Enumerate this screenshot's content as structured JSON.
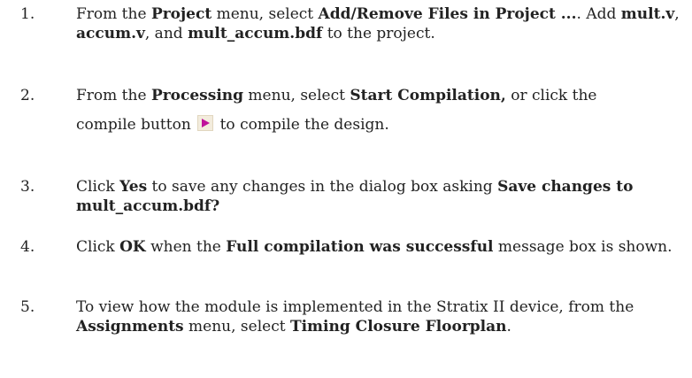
{
  "steps": [
    {
      "number": "1.",
      "parts": [
        "From the ",
        "Project",
        " menu, select ",
        "Add/Remove Files in Project ...",
        ". Add ",
        "mult.v",
        ", ",
        "accum.v",
        ", and ",
        "mult_accum.bdf",
        " to the project."
      ]
    },
    {
      "number": "2.",
      "parts": [
        "From the ",
        "Processing",
        " menu, select ",
        "Start Compilation,",
        " or click the",
        "compile button ",
        "to compile the design."
      ],
      "icon": "compile-play-icon"
    },
    {
      "number": "3.",
      "parts": [
        "Click ",
        "Yes",
        " to save any changes in the dialog box asking ",
        "Save changes to mult_accum.bdf?"
      ]
    },
    {
      "number": "4.",
      "parts": [
        "Click ",
        "OK",
        " when the ",
        "Full compilation was successful",
        " message box is shown."
      ]
    },
    {
      "number": "5.",
      "parts": [
        "To view how the module is implemented in the Stratix II device, from the ",
        "Assignments",
        " menu, select ",
        "Timing Closure Floorplan",
        "."
      ]
    }
  ],
  "colors": {
    "text": "#222222",
    "icon_play": "#c0129b",
    "icon_bg": "#f3ecdd"
  }
}
